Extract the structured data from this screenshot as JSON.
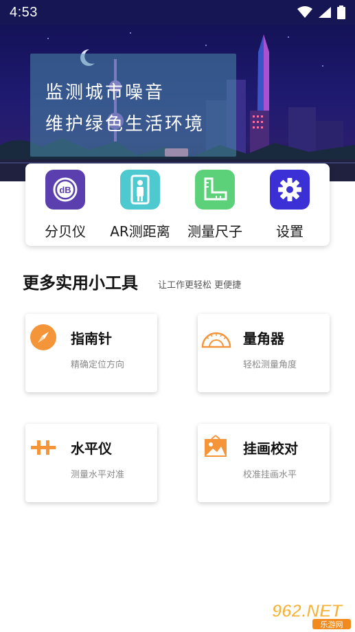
{
  "status_bar": {
    "time": "4:53",
    "icons": [
      "wifi-icon",
      "signal-icon",
      "battery-icon"
    ]
  },
  "banner": {
    "line1": "监测城市噪音",
    "line2": "维护绿色生活环境"
  },
  "quick_tools": [
    {
      "label": "分贝仪",
      "icon": "decibel-icon",
      "color": "#5b3fae"
    },
    {
      "label": "AR测距离",
      "icon": "ar-person-icon",
      "color": "#4ec9d0"
    },
    {
      "label": "测量尺子",
      "icon": "ruler-icon",
      "color": "#5cd17a"
    },
    {
      "label": "设置",
      "icon": "gear-icon",
      "color": "#3b2fd6"
    }
  ],
  "section": {
    "title": "更多实用小工具",
    "subtitle": "让工作更轻松 更便捷"
  },
  "tools": [
    {
      "title": "指南针",
      "desc": "精确定位方向",
      "icon": "compass-icon"
    },
    {
      "title": "量角器",
      "desc": "轻松测量角度",
      "icon": "protractor-icon"
    },
    {
      "title": "水平仪",
      "desc": "测量水平对准",
      "icon": "level-icon"
    },
    {
      "title": "挂画校对",
      "desc": "校准挂画水平",
      "icon": "picture-frame-icon"
    }
  ],
  "watermark": {
    "brand": "962.NET",
    "sub": "乐游网"
  },
  "accent_color": "#f4953a"
}
